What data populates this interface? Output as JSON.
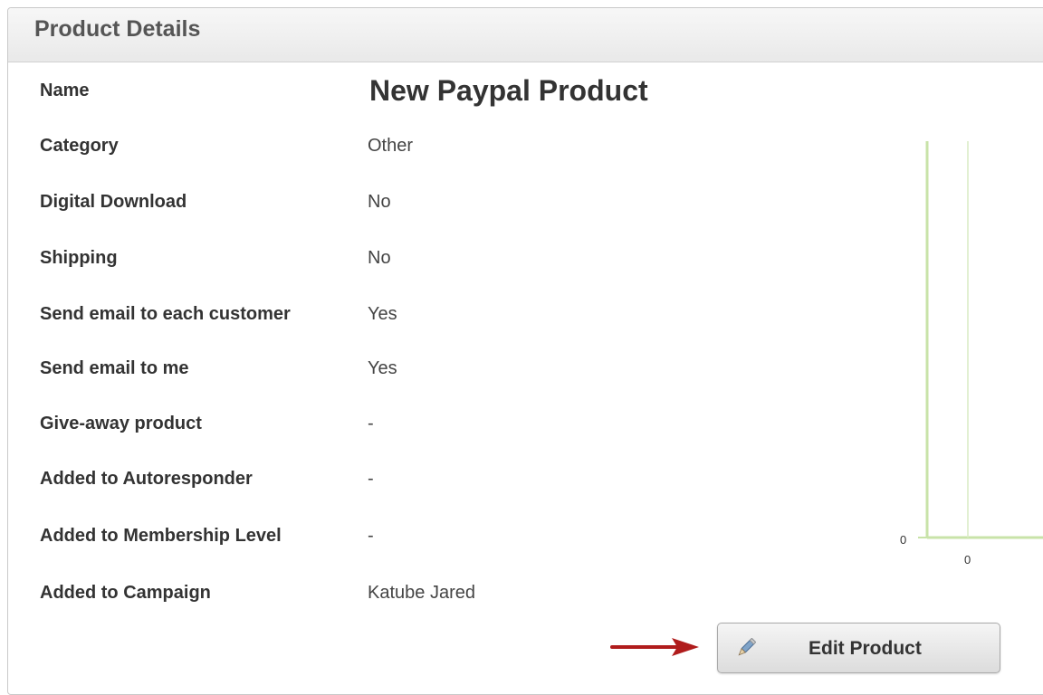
{
  "panel": {
    "title": "Product Details"
  },
  "details": [
    {
      "label": "Name",
      "value": "New Paypal Product"
    },
    {
      "label": "Category",
      "value": "Other"
    },
    {
      "label": "Digital Download",
      "value": "No"
    },
    {
      "label": "Shipping",
      "value": "No"
    },
    {
      "label": "Send email to each customer",
      "value": "Yes"
    },
    {
      "label": "Send email to me",
      "value": "Yes"
    },
    {
      "label": "Give-away product",
      "value": "-"
    },
    {
      "label": "Added to Autoresponder",
      "value": "-"
    },
    {
      "label": "Added to Membership Level",
      "value": "-"
    },
    {
      "label": "Added to Campaign",
      "value": "Katube Jared"
    }
  ],
  "chart": {
    "y_tick": "0",
    "x_tick": "0",
    "axis_color": "#c8e3a8"
  },
  "actions": {
    "edit_label": "Edit Product",
    "arrow_color": "#b01c1c"
  },
  "icons": {
    "edit": "pencil-icon",
    "pointer": "arrow-right-icon"
  }
}
